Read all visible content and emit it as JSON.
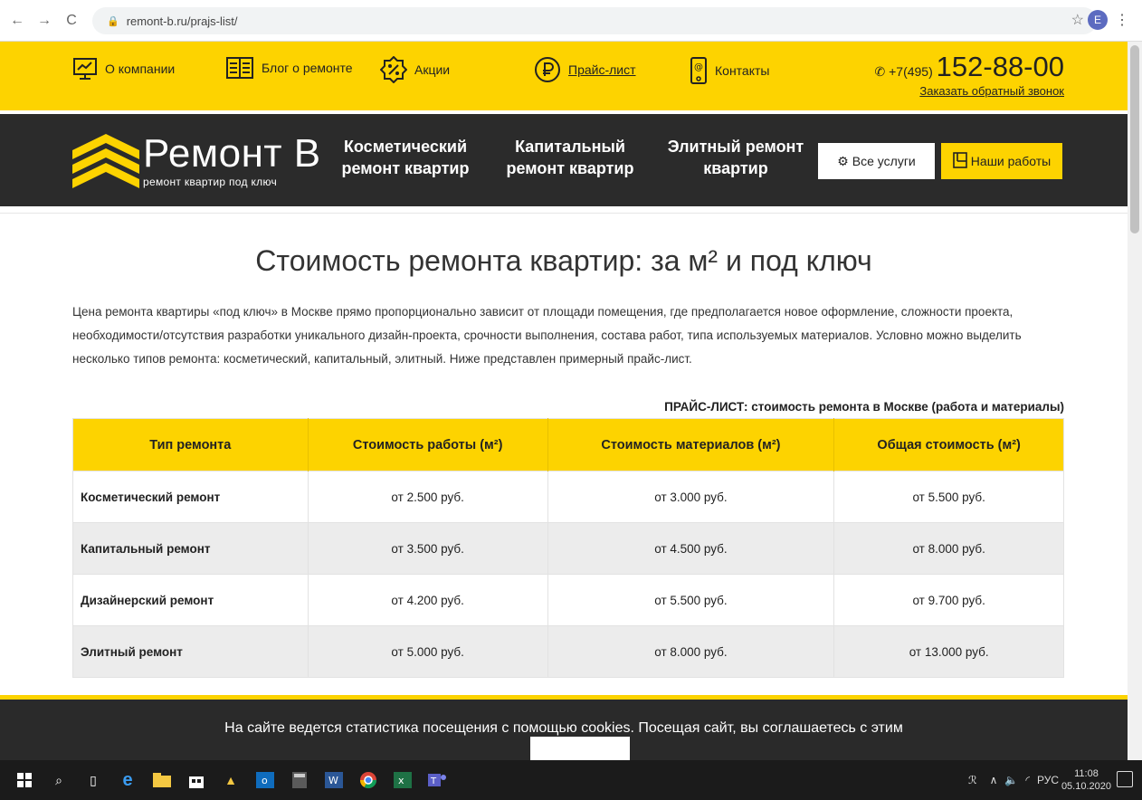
{
  "browser": {
    "url": "remont-b.ru/prajs-list/",
    "profile_initial": "E"
  },
  "topbar": {
    "items": [
      {
        "label": "О компании",
        "icon": "monitor-chart-icon"
      },
      {
        "label": "Блог о ремонте",
        "icon": "book-icon"
      },
      {
        "label": "Акции",
        "icon": "percent-badge-icon"
      },
      {
        "label": "Прайс-лист",
        "icon": "ruble-icon"
      },
      {
        "label": "Контакты",
        "icon": "phone-device-icon"
      }
    ],
    "phone_prefix": "+7(495)",
    "phone_main": "152-88-00",
    "callback": "Заказать обратный звонок"
  },
  "header": {
    "logo_title": "Ремонт B",
    "logo_subtitle": "ремонт квартир под ключ",
    "menu": [
      {
        "line1": "Косметический",
        "line2": "ремонт квартир"
      },
      {
        "line1": "Капитальный",
        "line2": "ремонт квартир"
      },
      {
        "line1": "Элитный ремонт",
        "line2": "квартир"
      }
    ],
    "all_services": "Все услуги",
    "our_works": "Наши работы"
  },
  "main": {
    "title": "Стоимость ремонта квартир: за м² и под ключ",
    "intro": "Цена ремонта квартиры «под ключ» в Москве прямо пропорционально зависит от площади помещения, где предполагается новое оформление, сложности проекта, необходимости/отсутствия разработки уникального дизайн-проекта, срочности выполнения, состава работ, типа используемых материалов. Условно можно выделить несколько типов ремонта: косметический, капитальный, элитный. Ниже представлен примерный прайс-лист.",
    "caption": "ПРАЙС-ЛИСТ: стоимость ремонта в Москве (работа и материалы)",
    "table": {
      "headers": [
        "Тип ремонта",
        "Стоимость работы (м²)",
        "Стоимость материалов (м²)",
        "Общая стоимость (м²)"
      ],
      "rows": [
        [
          "Косметический ремонт",
          "от 2.500 руб.",
          "от 3.000 руб.",
          "от 5.500 руб."
        ],
        [
          "Капитальный ремонт",
          "от 3.500 руб.",
          "от 4.500 руб.",
          "от 8.000 руб."
        ],
        [
          "Дизайнерский ремонт",
          "от 4.200 руб.",
          "от 5.500 руб.",
          "от 9.700 руб."
        ],
        [
          "Элитный ремонт",
          "от 5.000 руб.",
          "от 8.000 руб.",
          "от 13.000 руб."
        ]
      ]
    }
  },
  "cookie": {
    "text": "На сайте ведется статистика посещения с помощью cookies. Посещая сайт, вы соглашаетесь с этим"
  },
  "taskbar": {
    "lang": "РУС",
    "time": "11:08",
    "date": "05.10.2020"
  },
  "colors": {
    "accent": "#fdd300",
    "dark": "#2b2b2b"
  }
}
